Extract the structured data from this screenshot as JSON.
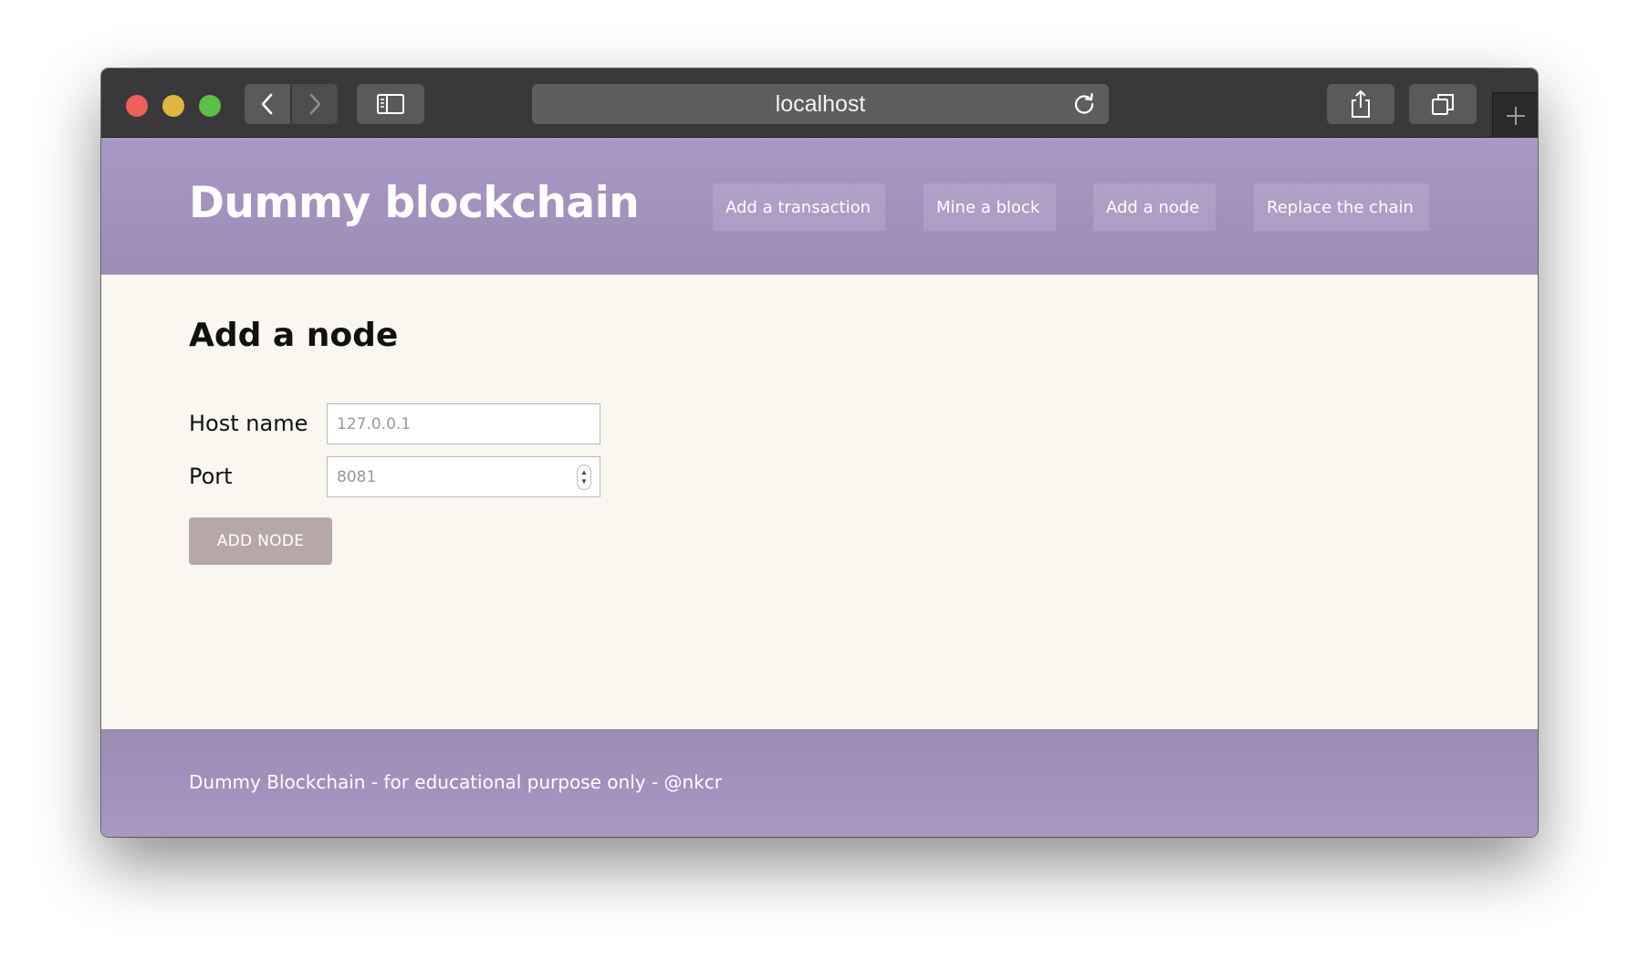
{
  "browser": {
    "url": "localhost",
    "icons": {
      "close": "close-light",
      "minimize": "minimize-light",
      "zoom": "zoom-light",
      "back": "chevron-left-icon",
      "forward": "chevron-right-icon",
      "sidebar": "sidebar-icon",
      "reload": "reload-icon",
      "share": "share-icon",
      "tabs": "tabs-icon",
      "new_tab": "plus-icon"
    }
  },
  "header": {
    "title": "Dummy blockchain",
    "nav": [
      {
        "label": "Add a transaction"
      },
      {
        "label": "Mine a block"
      },
      {
        "label": "Add a node"
      },
      {
        "label": "Replace the chain"
      }
    ]
  },
  "main": {
    "title": "Add a node",
    "host": {
      "label": "Host name",
      "value": "",
      "placeholder": "127.0.0.1"
    },
    "port": {
      "label": "Port",
      "value": "",
      "placeholder": "8081"
    },
    "submit_label": "ADD NODE"
  },
  "footer": {
    "text": "Dummy Blockchain - for educational purpose only - @nkcr"
  },
  "colors": {
    "header_bg": "#a998c5",
    "footer_bg": "#a897c4",
    "page_bg": "#f9f7f0",
    "button_bg": "#b7a7a9",
    "titlebar_bg": "#39393b"
  }
}
